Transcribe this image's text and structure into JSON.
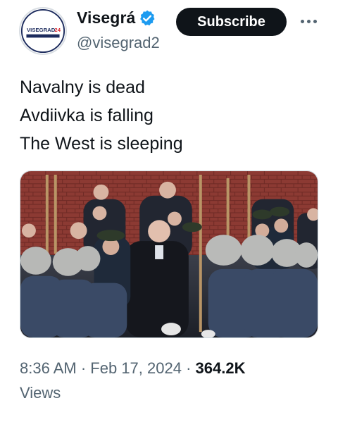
{
  "account": {
    "display_name": "Visegrá",
    "handle": "@visegrad2",
    "avatar_text": "VISEGRAD24",
    "verified_icon": "verified-badge-icon"
  },
  "actions": {
    "subscribe_label": "Subscribe",
    "more_icon": "more-dots-icon"
  },
  "tweet": {
    "lines": [
      "Navalny is dead",
      "Avdiivka is falling",
      "The West is sleeping"
    ]
  },
  "meta": {
    "time": "8:36 AM",
    "separator": "·",
    "date": "Feb 17, 2024",
    "views_count": "364.2K",
    "views_label": "Views"
  },
  "colors": {
    "accent": "#1d9bf0",
    "text": "#0f1419",
    "secondary": "#536471",
    "button_bg": "#0f1419"
  }
}
